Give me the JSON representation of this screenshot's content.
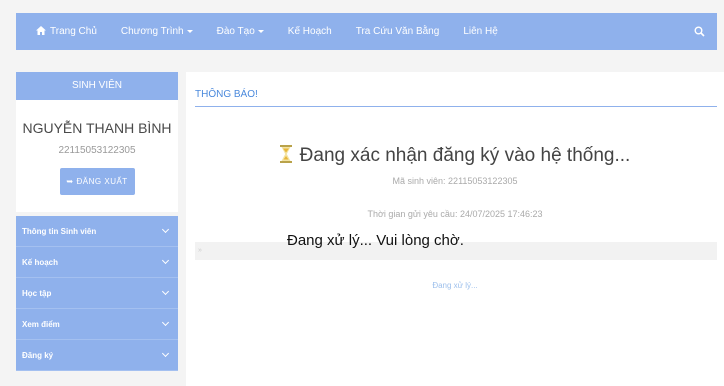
{
  "navbar": {
    "items": [
      {
        "label": "Trang Chủ",
        "icon": "home-icon"
      },
      {
        "label": "Chương Trình",
        "dropdown": true
      },
      {
        "label": "Đào Tạo",
        "dropdown": true
      },
      {
        "label": "Kế Hoạch"
      },
      {
        "label": "Tra Cứu Văn Bằng"
      },
      {
        "label": "Liên Hệ"
      }
    ],
    "search_icon": "search-icon"
  },
  "sidebar": {
    "header": "SINH VIÊN",
    "name": "NGUYỄN THANH BÌNH",
    "student_id": "22115053122305",
    "logout_label": "ĐĂNG XUẤT",
    "menu": [
      {
        "label": "Thông tin Sinh viên"
      },
      {
        "label": "Kế hoạch"
      },
      {
        "label": "Học tập"
      },
      {
        "label": "Xem điểm"
      },
      {
        "label": "Đăng ký"
      }
    ]
  },
  "main": {
    "title": "THÔNG BÁO!",
    "status": "Đang xác nhận đăng ký vào hệ thống...",
    "student_line": "Mã sinh viên: 22115053122305",
    "time_line": "Thời gian gửi yêu cầu: 24/07/2025 17:46:23",
    "overlay": "Đang xử lý... Vui lòng chờ.",
    "processing": "Đang xử lý...",
    "progress": 0.0
  },
  "colors": {
    "accent": "#8fb1ec",
    "title_blue": "#4a89dc",
    "hourglass": "#e8c84a"
  }
}
